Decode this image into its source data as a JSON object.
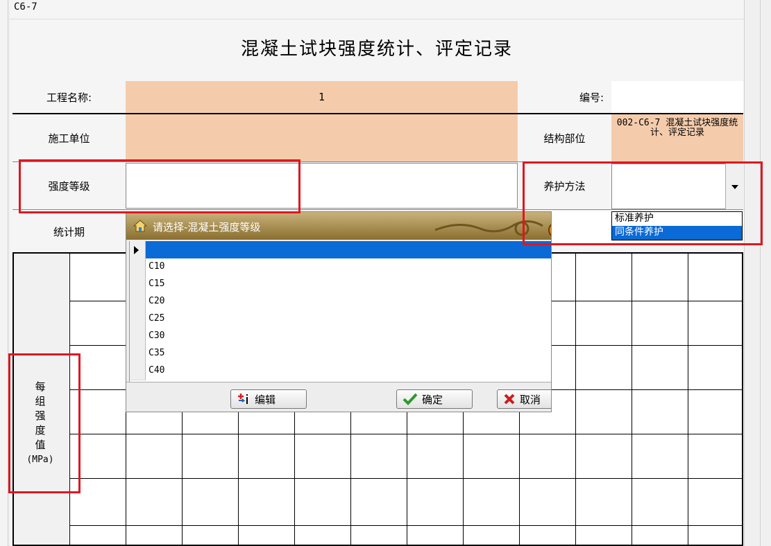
{
  "sheet": {
    "code": "C6-7",
    "title": "混凝土试块强度统计、评定记录"
  },
  "row_project": {
    "label": "工程名称:",
    "value": "1",
    "number_label": "编号:",
    "number_value": ""
  },
  "row_unit": {
    "label": "施工单位",
    "value": "",
    "structure_label": "结构部位",
    "structure_value": "002-C6-7 混凝土试块强度统计、评定记录"
  },
  "row_grade": {
    "label": "强度等级",
    "value": "",
    "curing_label": "养护方法",
    "curing_value": ""
  },
  "row_period": {
    "label": "统计期"
  },
  "strength_label": {
    "chars": [
      "每",
      "组",
      "强",
      "度",
      "值"
    ],
    "unit": "(MPa)"
  },
  "curing_dropdown": {
    "options": [
      "标准养护",
      "同条件养护"
    ],
    "selected_index": 1
  },
  "dialog": {
    "title": "请选择-混凝土强度等级",
    "rows": [
      "",
      "C10",
      "C15",
      "C20",
      "C25",
      "C30",
      "C35",
      "C40"
    ],
    "selected_index": 0,
    "buttons": {
      "edit": "编辑",
      "confirm": "确定",
      "cancel": "取消"
    }
  },
  "colors": {
    "peach": "#f4ccac",
    "highlight": "#e0161e",
    "selection": "#0a6ad6"
  }
}
